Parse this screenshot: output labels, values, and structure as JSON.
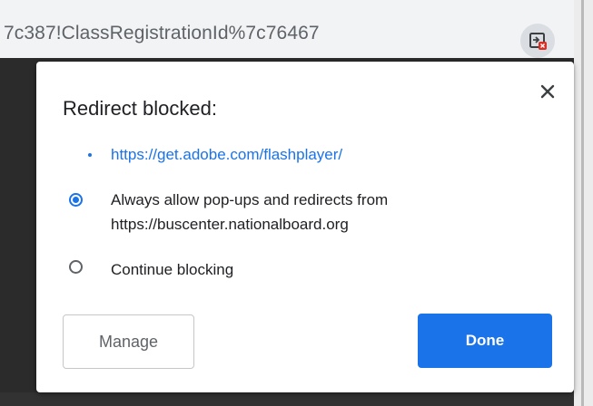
{
  "omnibox": {
    "url_text": "7c387!ClassRegistrationId%7c76467",
    "blocked_icon": "redirect-blocked-icon"
  },
  "dialog": {
    "title": "Redirect blocked:",
    "blocked_link": "https://get.adobe.com/flashplayer/",
    "options": [
      {
        "label": "Always allow pop-ups and redirects from https://buscenter.nationalboard.org",
        "selected": true
      },
      {
        "label": "Continue blocking",
        "selected": false
      }
    ],
    "close_icon": "close-icon",
    "manage_label": "Manage",
    "done_label": "Done"
  },
  "colors": {
    "accent": "#1a73e8",
    "text": "#202124",
    "secondary_text": "#5f6368",
    "page_background": "#2b2b2b"
  }
}
